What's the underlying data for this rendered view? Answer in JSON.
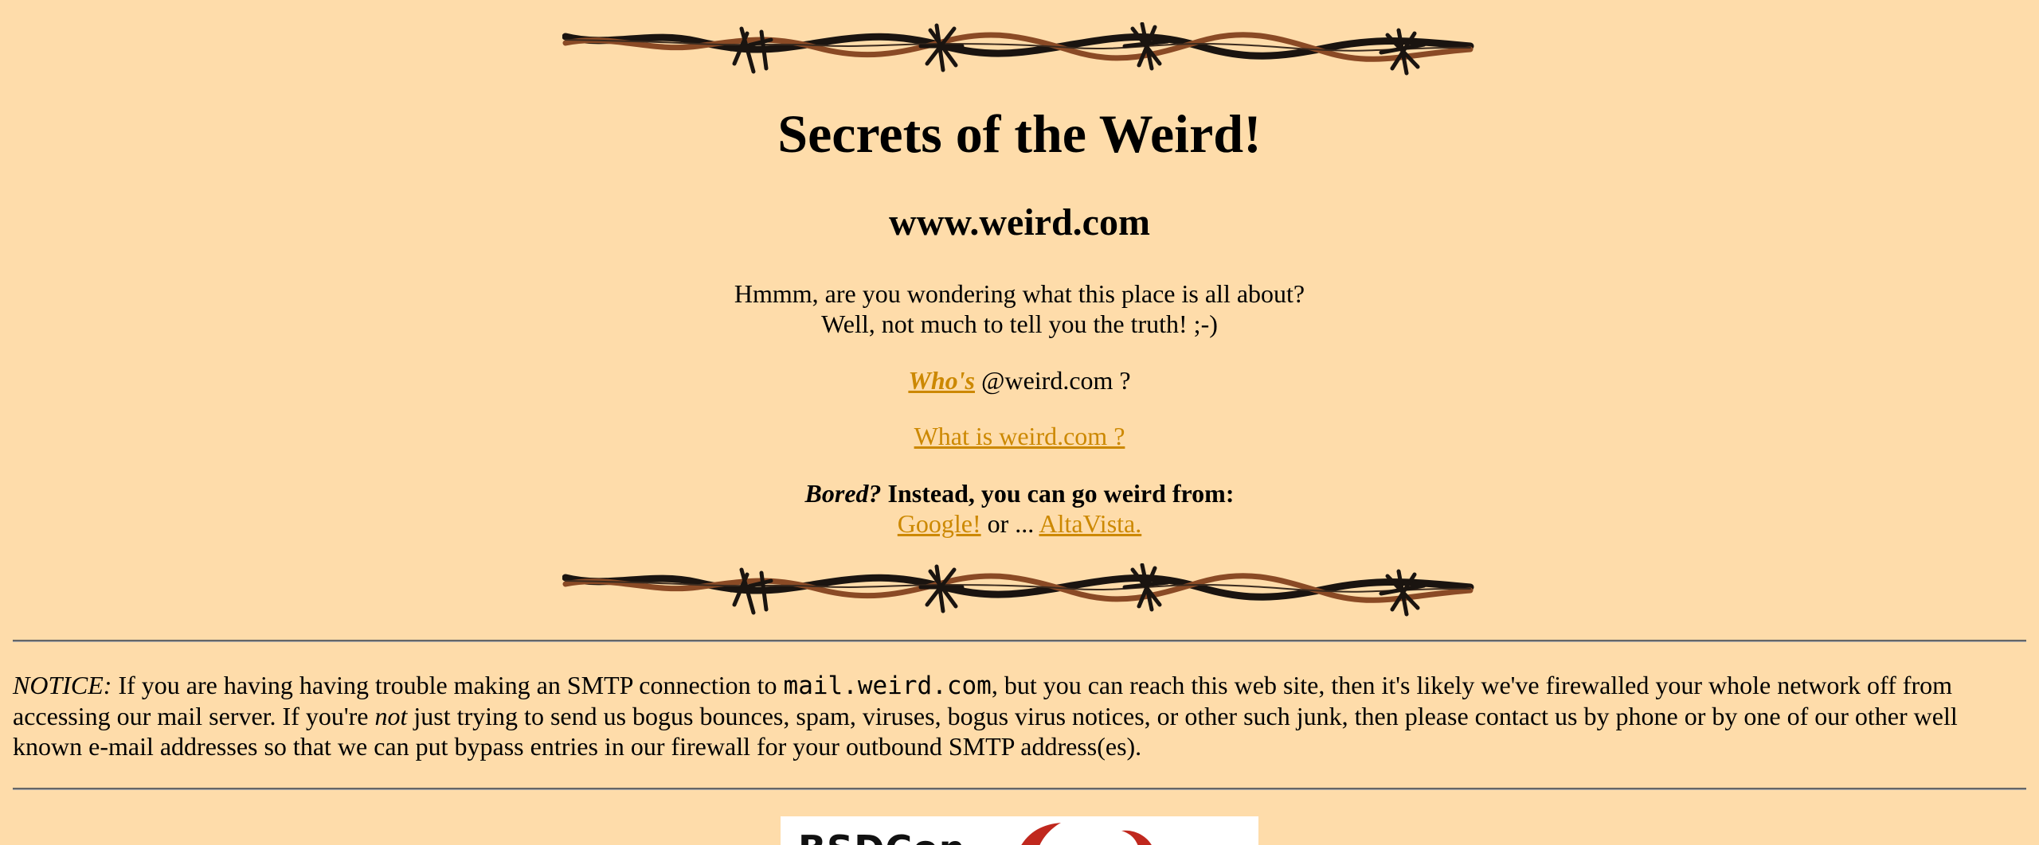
{
  "page": {
    "title": "Secrets of the Weird!",
    "subtitle": "www.weird.com",
    "intro_line1": "Hmmm, are you wondering what this place is all about?",
    "intro_line2": "Well, not much to tell you the truth! ;-)",
    "whos_link": "Who's",
    "whos_suffix": " @weird.com ?",
    "what_link": "What is weird.com ?",
    "bored_label": "Bored?",
    "bored_text": " Instead, you can go weird from:",
    "google_link": "Google!",
    "or_text": " or ... ",
    "altavista_link": "AltaVista."
  },
  "notice": {
    "label": "NOTICE:",
    "text1": " If you are having having trouble making an SMTP connection to ",
    "host": "mail.weird.com",
    "text2": ", but you can reach this web site, then it's likely we've firewalled your whole network off from accessing our mail server. If you're ",
    "emphasis": "not",
    "text3": " just trying to send us bogus bounces, spam, viruses, bogus virus notices, or other such junk, then please contact us by phone or by one of our other well known e-mail addresses so that we can put bypass entries in our firewall for your outbound SMTP address(es)."
  },
  "banner": {
    "text": "BSDCon"
  },
  "colors": {
    "background": "#fedcaa",
    "link": "#cc8800",
    "wire_dark": "#1a1410",
    "wire_rust": "#8a4a25"
  },
  "icons": {
    "barbed_wire": "barbed-wire-divider"
  }
}
